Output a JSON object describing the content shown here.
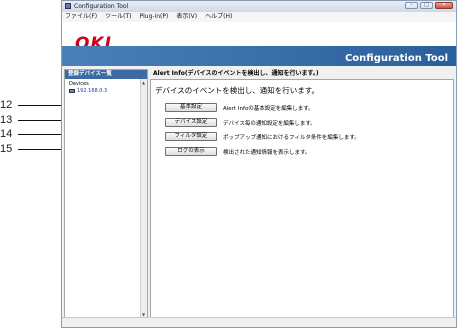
{
  "window": {
    "title": "Configuration Tool"
  },
  "menu": [
    "ファイル(F)",
    "ツール(T)",
    "Plug-in(P)",
    "表示(V)",
    "ヘルプ(H)"
  ],
  "banner": {
    "logo": "OKI",
    "app_title": "Configuration Tool"
  },
  "sidebar": {
    "header": "登録デバイス一覧",
    "group": "Devices",
    "device": "192.168.0.3"
  },
  "main": {
    "header": "Alert Info(デバイスのイベントを検出し、通知を行います。)",
    "subtitle": "デバイスのイベントを検出し、通知を行います。",
    "rows": [
      {
        "button": "基本設定",
        "desc": "Alert Infoの基本設定を編集します。"
      },
      {
        "button": "デバイス設定",
        "desc": "デバイス毎の通知設定を編集します。"
      },
      {
        "button": "フィルタ設定",
        "desc": "ポップアップ通知におけるフィルタ条件を編集します。"
      },
      {
        "button": "ログの表示",
        "desc": "検出された通知情報を表示します。"
      }
    ]
  },
  "callouts": [
    "12",
    "13",
    "14",
    "15"
  ]
}
